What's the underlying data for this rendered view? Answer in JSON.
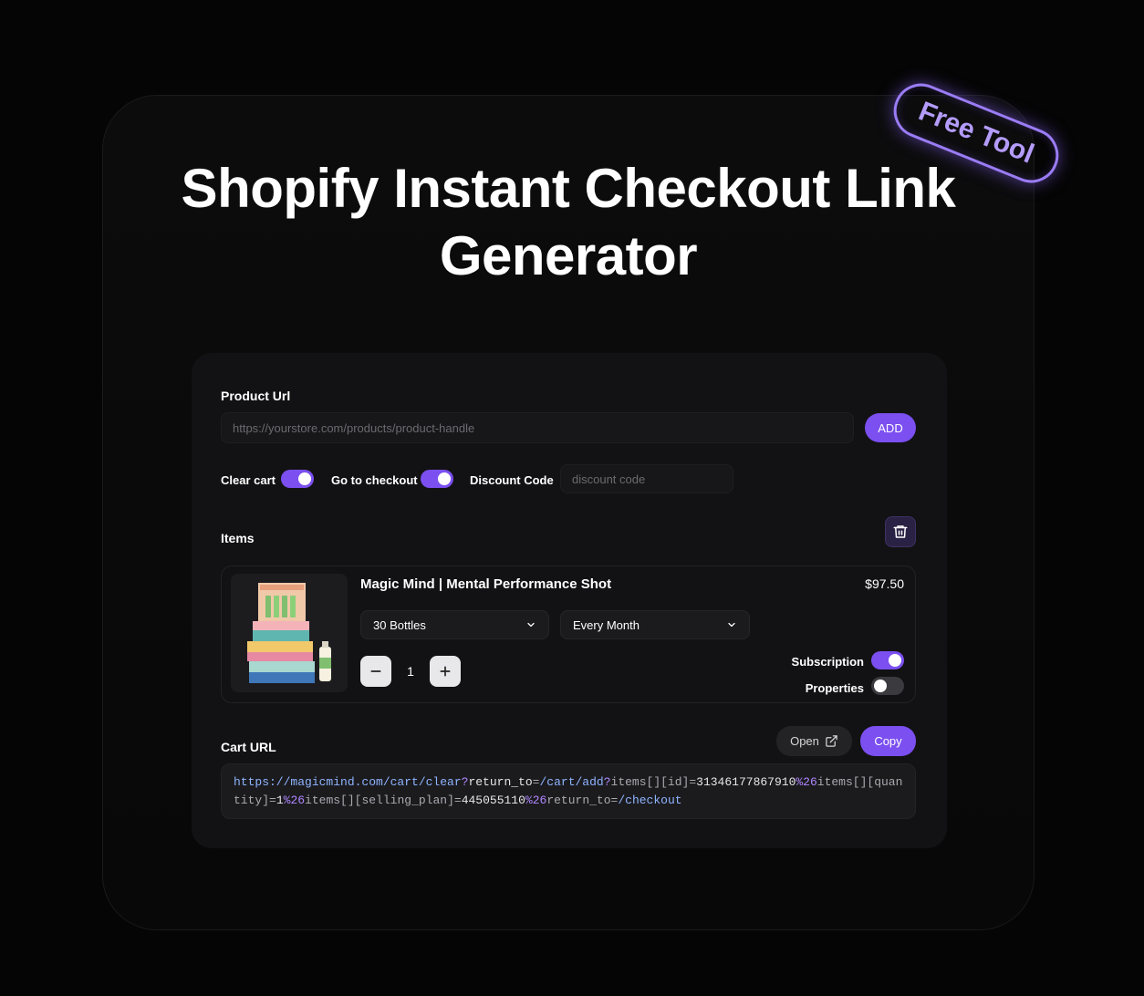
{
  "page": {
    "title": "Shopify Instant Checkout Link Generator",
    "badge": "Free Tool"
  },
  "form": {
    "product_url_label": "Product Url",
    "product_url_placeholder": "https://yourstore.com/products/product-handle",
    "add_label": "ADD",
    "clear_cart_label": "Clear cart",
    "clear_cart_on": true,
    "go_to_checkout_label": "Go to checkout",
    "go_to_checkout_on": true,
    "discount_code_label": "Discount Code",
    "discount_code_placeholder": "discount code"
  },
  "items": {
    "label": "Items",
    "list": [
      {
        "name": "Magic Mind | Mental Performance Shot",
        "price": "$97.50",
        "variant": "30 Bottles",
        "plan": "Every Month",
        "quantity": "1",
        "subscription_label": "Subscription",
        "subscription_on": true,
        "properties_label": "Properties",
        "properties_on": false
      }
    ]
  },
  "cart": {
    "label": "Cart URL",
    "open_label": "Open",
    "copy_label": "Copy",
    "url_segments": [
      {
        "text": "https://magicmind.com/cart/clear",
        "tone": "blue"
      },
      {
        "text": "?",
        "tone": "purple"
      },
      {
        "text": "return_to",
        "tone": "white"
      },
      {
        "text": "=",
        "tone": "grey"
      },
      {
        "text": "/cart/add",
        "tone": "blue"
      },
      {
        "text": "?",
        "tone": "purple"
      },
      {
        "text": "items[][id]",
        "tone": "grey"
      },
      {
        "text": "=",
        "tone": "grey"
      },
      {
        "text": "31346177867910",
        "tone": "white"
      },
      {
        "text": "%26",
        "tone": "purple"
      },
      {
        "text": "items[][quantity]",
        "tone": "grey"
      },
      {
        "text": "=",
        "tone": "grey"
      },
      {
        "text": "1",
        "tone": "white"
      },
      {
        "text": "%26",
        "tone": "purple"
      },
      {
        "text": "items[][selling_plan]",
        "tone": "grey"
      },
      {
        "text": "=",
        "tone": "grey"
      },
      {
        "text": "445055110",
        "tone": "white"
      },
      {
        "text": "%26",
        "tone": "purple"
      },
      {
        "text": "return_to",
        "tone": "grey"
      },
      {
        "text": "=",
        "tone": "grey"
      },
      {
        "text": "/checkout",
        "tone": "blue"
      }
    ]
  },
  "icons": {
    "trash": "trash-icon",
    "chevron": "chevron-down-icon",
    "external": "external-link-icon"
  },
  "colors": {
    "accent": "#7b4ff0",
    "badge": "#9a7cf5",
    "background": "#050505",
    "card": "#121214"
  }
}
